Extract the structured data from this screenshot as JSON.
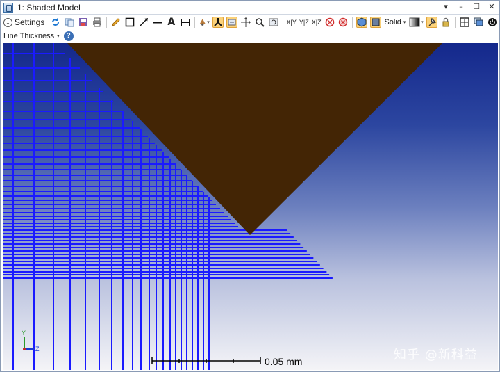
{
  "window": {
    "title": "1: Shaded Model",
    "controls": [
      "▾",
      "–",
      "☐",
      "✕"
    ]
  },
  "toolbar": {
    "settings_label": "Settings",
    "solid_label": "Solid",
    "xy_label": "X|Y",
    "yz_label": "Y|Z",
    "xz_label": "X|Z",
    "text_tool_label": "A"
  },
  "toolbar2": {
    "line_thickness_label": "Line Thickness",
    "help_glyph": "?"
  },
  "viewport": {
    "scale_bar_label": "0.05 mm",
    "triad": {
      "y_label": "Y",
      "z_label": "Z"
    },
    "watermark": "知乎 @新科益",
    "colors": {
      "mesh": "#1a1aff",
      "lens_body": "#432505",
      "bg_top": "#14288c",
      "bg_bottom": "#f4f4f7"
    }
  }
}
